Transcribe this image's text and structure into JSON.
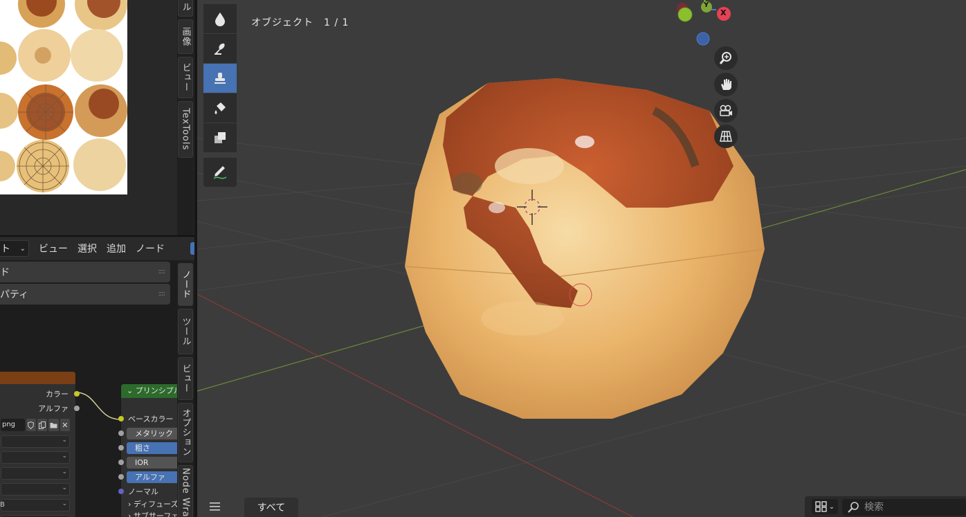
{
  "image_editor": {
    "tabs": [
      "ル",
      "画像",
      "ビュー",
      "TexTools"
    ]
  },
  "node_editor": {
    "header": {
      "mode_label": "ト",
      "menus": [
        "ビュー",
        "選択",
        "追加",
        "ノード"
      ]
    },
    "panels": [
      "ド",
      "パティ"
    ],
    "texture_node": {
      "outputs": [
        "カラー",
        "アルファ"
      ],
      "image_name": "png"
    },
    "principled_node": {
      "title": "プリンシプル",
      "input_base_color": "ベースカラー",
      "fields": [
        {
          "label": "メタリック",
          "style": "grey"
        },
        {
          "label": "粗さ",
          "style": "blue"
        },
        {
          "label": "IOR",
          "style": "grey"
        },
        {
          "label": "アルファ",
          "style": "blue"
        }
      ],
      "normal": "ノーマル",
      "diffuse": "ディフューズ",
      "subsurface": "サブサーフェ"
    },
    "sidebar_tabs": [
      "ノード",
      "ツール",
      "ビュー",
      "オプション",
      "Node Wra"
    ],
    "row_value": "B"
  },
  "viewport": {
    "object_count": "オブジェクト　1 / 1",
    "gizmo": {
      "x_label": "X",
      "y_label": "Y"
    },
    "nav_buttons": [
      "zoom-icon",
      "hand-icon",
      "camera-icon",
      "grid-icon"
    ],
    "colors": {
      "x_axis": "#e64155",
      "y_axis": "#8cbf2e",
      "z_axis": "#4e7ac9",
      "active_tool": "#4772b3"
    }
  },
  "bottom_bar": {
    "tab_all": "すべて",
    "search_placeholder": "検索"
  }
}
